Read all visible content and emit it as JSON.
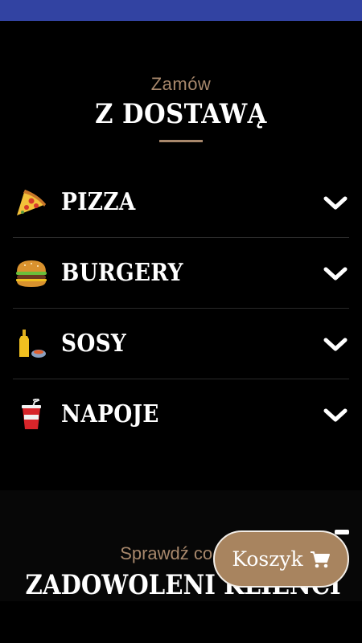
{
  "header": {
    "kicker": "Zamów",
    "title": "Z DOSTAWĄ"
  },
  "menu": {
    "items": [
      {
        "label": "PIZZA",
        "icon": "pizza-icon"
      },
      {
        "label": "BURGERY",
        "icon": "burger-icon"
      },
      {
        "label": "SOSY",
        "icon": "sauce-icon"
      },
      {
        "label": "NAPOJE",
        "icon": "drink-icon"
      }
    ]
  },
  "section2": {
    "kicker": "Sprawdź co mó",
    "title": "ZADOWOLENI KLIENCI"
  },
  "cart": {
    "label": "Koszyk",
    "icon": "cart-icon"
  },
  "colors": {
    "status_bar": "#3243a2",
    "accent": "#a8886c",
    "cart_bg": "#a8845f",
    "background": "#000000"
  }
}
